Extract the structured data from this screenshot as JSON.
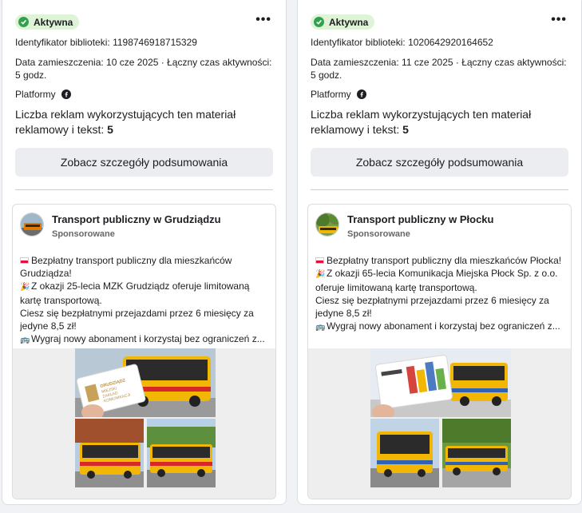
{
  "cards": [
    {
      "status": "Aktywna",
      "library_id": "Identyfikator biblioteki: 1198746918715329",
      "date": "Data zamieszczenia: 10 cze 2025 · Łączny czas aktywności: 5 godz.",
      "platforms_label": "Platformy",
      "ads_text": "Liczba reklam wykorzystujących ten materiał reklamowy i tekst: ",
      "ads_count": "5",
      "summary_button": "Zobacz szczegóły podsumowania",
      "ad": {
        "page_name": "Transport publiczny w Grudziądzu",
        "sponsored": "Sponsorowane",
        "lines": [
          "Bezpłatny transport publiczny dla mieszkańców Grudziądza!",
          "Z okazji 25-lecia MZK Grudziądz oferuje limitowaną kartę transportową.",
          " Ciesz się bezpłatnymi przejazdami przez 6 miesięcy za jedyne 8,5 zł!",
          "Wygraj nowy abonament i korzystaj bez ograniczeń z..."
        ],
        "card_text": "GRUDZIĄDZ MIEJSKI ZAKŁAD KOMUNIKACJI"
      }
    },
    {
      "status": "Aktywna",
      "library_id": "Identyfikator biblioteki: 1020642920164652",
      "date": "Data zamieszczenia: 11 cze 2025 · Łączny czas aktywności: 5 godz.",
      "platforms_label": "Platformy",
      "ads_text": "Liczba reklam wykorzystujących ten materiał reklamowy i tekst: ",
      "ads_count": "5",
      "summary_button": "Zobacz szczegóły podsumowania",
      "ad": {
        "page_name": "Transport publiczny w Płocku",
        "sponsored": "Sponsorowane",
        "lines": [
          "Bezpłatny transport publiczny dla mieszkańców Płocka!",
          "Z okazji 65-lecia Komunikacja Miejska Płock Sp. z o.o. oferuje limitowaną kartę transportową.",
          " Ciesz się bezpłatnymi przejazdami przez 6 miesięcy za jedyne 8,5 zł!",
          "Wygraj nowy abonament i korzystaj bez ograniczeń z..."
        ]
      }
    }
  ],
  "icons": {
    "status": "check-circle-icon",
    "more": "more-horizontal-icon",
    "platform": "facebook-icon",
    "line1": "poland-flag-icon",
    "line2": "party-popper-icon",
    "line4": "bus-icon"
  },
  "colors": {
    "status_bg": "#dff3d6",
    "status_check": "#31a24c",
    "button_bg": "#ebedf0",
    "bus_yellow": "#f2b705",
    "bus_red": "#d62828"
  }
}
